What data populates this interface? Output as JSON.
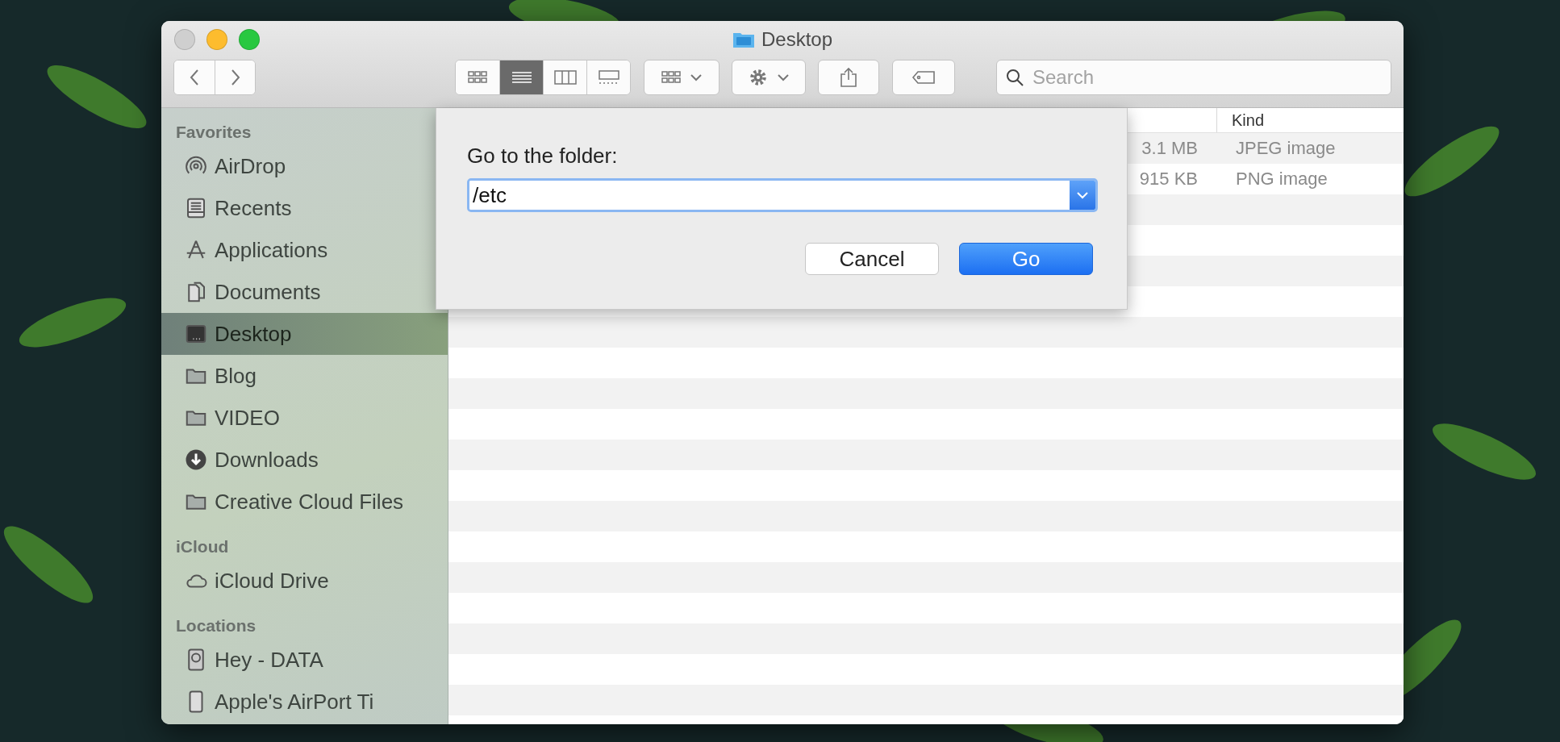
{
  "window": {
    "title": "Desktop"
  },
  "toolbar": {
    "view_modes": [
      {
        "kind": "icons",
        "selected": false
      },
      {
        "kind": "list",
        "selected": true
      },
      {
        "kind": "columns",
        "selected": false
      },
      {
        "kind": "gallery",
        "selected": false
      }
    ],
    "search": {
      "placeholder": "Search"
    }
  },
  "sidebar": {
    "sections": [
      {
        "title": "Favorites",
        "items": [
          {
            "label": "AirDrop",
            "kind": "airdrop",
            "selected": false
          },
          {
            "label": "Recents",
            "kind": "recents",
            "selected": false
          },
          {
            "label": "Applications",
            "kind": "apps",
            "selected": false
          },
          {
            "label": "Documents",
            "kind": "documents",
            "selected": false
          },
          {
            "label": "Desktop",
            "kind": "desktop",
            "selected": true
          },
          {
            "label": "Blog",
            "kind": "folder",
            "selected": false
          },
          {
            "label": "VIDEO",
            "kind": "folder",
            "selected": false
          },
          {
            "label": "Downloads",
            "kind": "downloads",
            "selected": false
          },
          {
            "label": "Creative Cloud Files",
            "kind": "folder",
            "selected": false
          }
        ]
      },
      {
        "title": "iCloud",
        "items": [
          {
            "label": "iCloud Drive",
            "kind": "cloud",
            "selected": false
          }
        ]
      },
      {
        "title": "Locations",
        "items": [
          {
            "label": "Hey - DATA",
            "kind": "disk",
            "selected": false
          },
          {
            "label": "Apple's AirPort Ti",
            "kind": "device",
            "selected": false
          }
        ]
      }
    ]
  },
  "file_list": {
    "columns": [
      {
        "label": "Kind"
      }
    ],
    "rows": [
      {
        "column_2": "3.1 MB",
        "kind": "JPEG image"
      },
      {
        "column_2": "915 KB",
        "kind": "PNG image"
      }
    ]
  },
  "go_to_folder_dialog": {
    "label": "Go to the folder:",
    "value": "/etc",
    "buttons": [
      {
        "label": "Cancel",
        "kind": "secondary"
      },
      {
        "label": "Go",
        "kind": "primary"
      }
    ]
  }
}
